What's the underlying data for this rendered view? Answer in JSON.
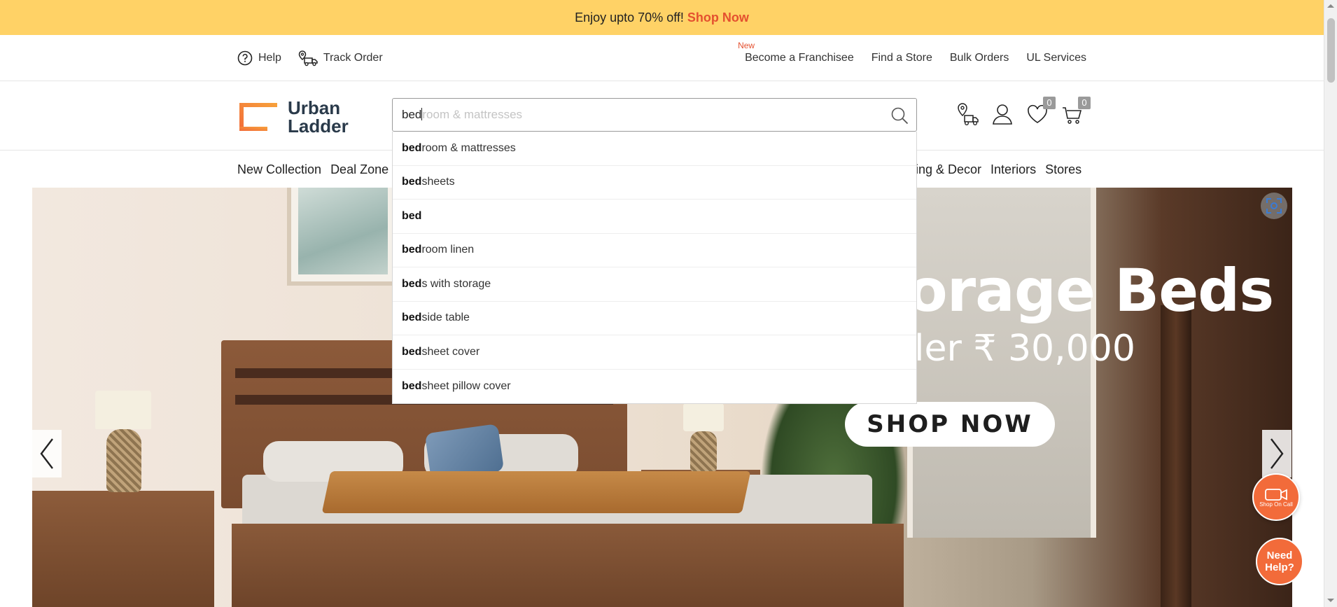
{
  "promo": {
    "text": "Enjoy upto 70% off!",
    "link": "Shop Now"
  },
  "utility": {
    "left": [
      {
        "label": "Help",
        "icon": "help-circle-icon"
      },
      {
        "label": "Track Order",
        "icon": "delivery-truck-icon"
      }
    ],
    "new_badge": "New",
    "right": [
      "Become a Franchisee",
      "Find a Store",
      "Bulk Orders",
      "UL Services"
    ]
  },
  "brand": {
    "line1": "Urban",
    "line2": "Ladder",
    "accent": "#f26b3a",
    "text_color": "#2a3a4a"
  },
  "search": {
    "typed": "bed",
    "ghost": "room & mattresses",
    "placeholder": "Search"
  },
  "header_icons": {
    "wishlist_count": "0",
    "cart_count": "0"
  },
  "nav": {
    "left": [
      "New Collection",
      "Deal Zone"
    ],
    "right": [
      "ing & Decor",
      "Interiors",
      "Stores"
    ]
  },
  "suggestions": [
    {
      "bold": "bed",
      "rest": "room & mattresses"
    },
    {
      "bold": "bed",
      "rest": "sheets"
    },
    {
      "bold": "bed",
      "rest": ""
    },
    {
      "bold": "bed",
      "rest": "room linen"
    },
    {
      "bold": "bed",
      "rest": "s with storage"
    },
    {
      "bold": "bed",
      "rest": "side table"
    },
    {
      "bold": "bed",
      "rest": "sheet cover"
    },
    {
      "bold": "bed",
      "rest": "sheet pillow cover"
    }
  ],
  "hero": {
    "title": "orage Beds",
    "subtitle": "ler ₹ 30,000",
    "cta": "SHOP NOW"
  },
  "fabs": {
    "call_label": "Shop On Call",
    "help_line1": "Need",
    "help_line2": "Help?"
  },
  "colors": {
    "promo_bg": "#ffd266",
    "promo_link": "#e4502f",
    "fab": "#f26b3a"
  }
}
